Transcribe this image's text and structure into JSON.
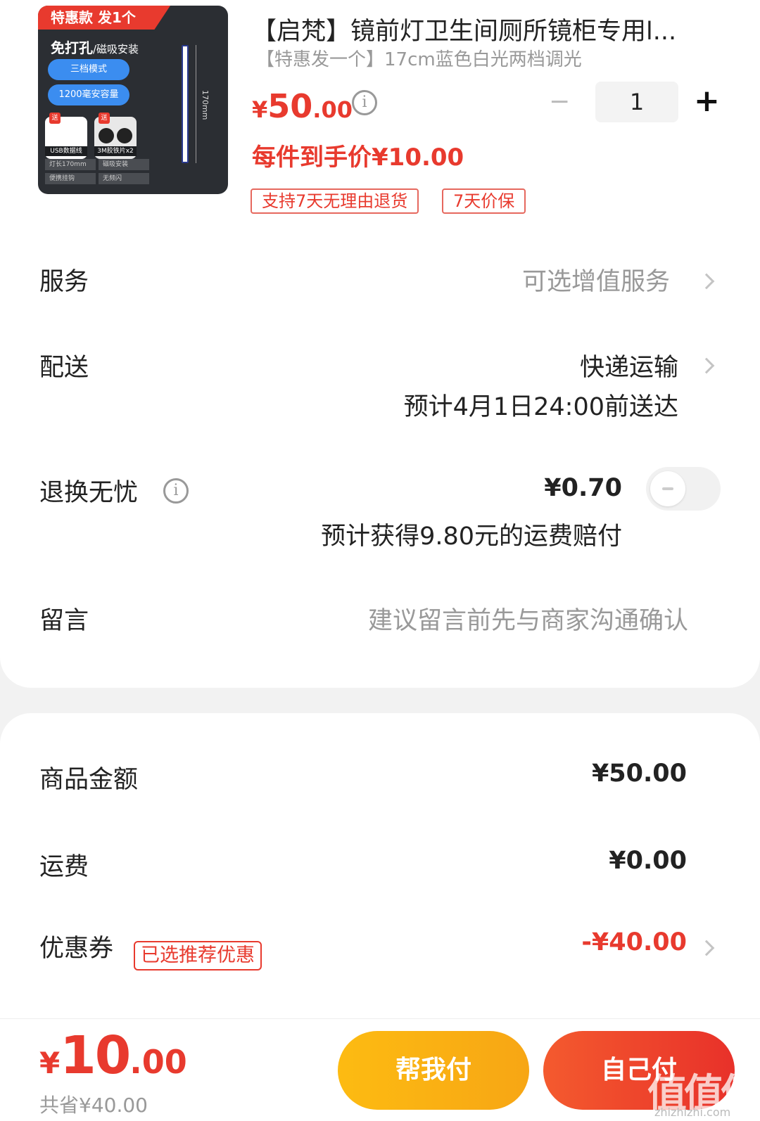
{
  "product": {
    "thumb": {
      "ribbon": "特惠款 发1个",
      "headline": "免打孔",
      "headline_sub": "/磁吸安装",
      "pill_1": "三档模式",
      "pill_2": "1200毫安容量",
      "acc_1": "USB数据线",
      "acc_2": "3M胶铁片x2",
      "send_tag": "送",
      "spec_1": "灯长170mm",
      "spec_2": "磁吸安装",
      "spec_3": "便携挂钩",
      "spec_4": "无频闪",
      "dimension": "170mm"
    },
    "title": "【启梵】镜前灯卫生间厕所镜柜专用l...",
    "variant": "【特惠发一个】17cm蓝色白光两档调光",
    "price_symbol": "¥",
    "price_int": "50",
    "price_dec": ".00",
    "quantity": "1",
    "unit_price_text": "每件到手价¥10.00",
    "tags": [
      "支持7天无理由退货",
      "7天价保"
    ]
  },
  "rows": {
    "service_label": "服务",
    "service_value": "可选增值服务",
    "delivery_label": "配送",
    "delivery_value": "快递运输",
    "delivery_eta": "预计4月1日24:00前送达",
    "return_label": "退换无忧",
    "return_price": "¥0.70",
    "return_note": "预计获得9.80元的运费赔付",
    "return_toggle_on": false,
    "message_label": "留言",
    "message_placeholder": "建议留言前先与商家沟通确认"
  },
  "summary": {
    "goods_label": "商品金额",
    "goods_value": "¥50.00",
    "shipping_label": "运费",
    "shipping_value": "¥0.00",
    "coupon_label": "优惠券",
    "coupon_badge": "已选推荐优惠",
    "coupon_value": "-¥40.00"
  },
  "footer": {
    "total_symbol": "¥",
    "total_int": "10",
    "total_dec": ".00",
    "saved_text": "共省¥40.00",
    "help_pay_label": "帮我付",
    "self_pay_label": "自己付",
    "watermark": "值值值",
    "watermark_sub": "zhizhizhi.com"
  },
  "colors": {
    "accent_red": "#e83a2e",
    "help_btn": "#fdbb12",
    "self_btn": "#e8312a"
  }
}
